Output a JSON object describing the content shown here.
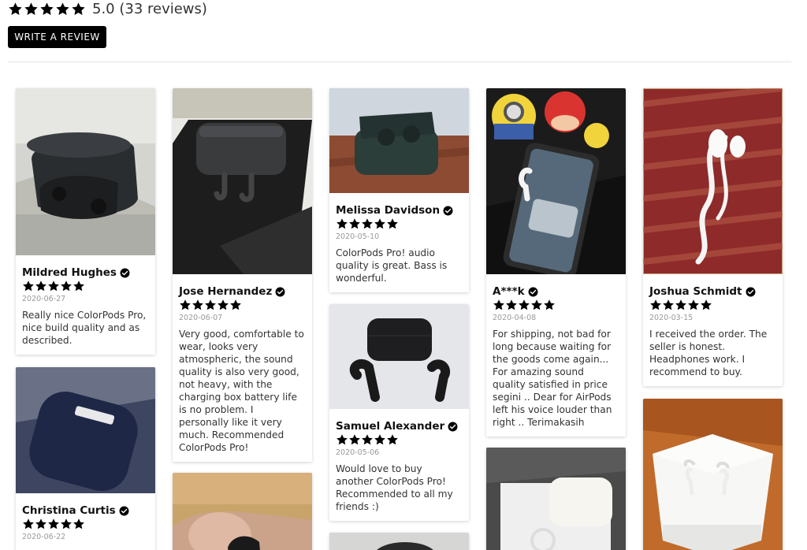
{
  "summary": {
    "score_text": "5.0 (33 reviews)",
    "stars": 5
  },
  "write_button": {
    "label": "WRITE A REVIEW"
  },
  "colors": {
    "star": "#000000",
    "button_bg": "#000000",
    "button_text": "#ffffff"
  },
  "reviews": [
    {
      "name": "Mildred Hughes",
      "date": "2020-06-27",
      "text": "Really nice ColorPods Pro, nice build quality and as described.",
      "rating": 5,
      "photo": "black earbuds case photo"
    },
    {
      "name": "Christina Curtis",
      "date": "2020-06-22",
      "text": "",
      "rating": 5,
      "photo": "navy earbuds case photo"
    },
    {
      "name": "Jose Hernandez",
      "date": "2020-06-07",
      "text": "Very good, comfortable to wear, looks very atmospheric, the sound quality is also very good, not heavy, with the charging box battery life is no problem. I personally like it very much. Recommended ColorPods Pro!",
      "rating": 5,
      "photo": "black case with earbuds photo"
    },
    {
      "name": "Melissa Davidson",
      "date": "2020-05-10",
      "text": "ColorPods Pro! audio quality is great. Bass is wonderful.",
      "rating": 5,
      "photo": "open case on wood photo"
    },
    {
      "name": "Samuel Alexander",
      "date": "2020-05-06",
      "text": "Would love to buy another ColorPods Pro! Recommended to all my friends :)",
      "rating": 5,
      "photo": "black case and earbuds on white photo"
    },
    {
      "name": "A***k",
      "date": "2020-04-08",
      "text": "For shipping, not bad for long because waiting for the goods come again... For amazing sound quality satisfied in price segini .. Dear for AirPods left his voice louder than right .. Terimakasih",
      "rating": 5,
      "photo": "phone with figurines photo"
    },
    {
      "name": "Joshua Schmidt",
      "date": "2020-03-15",
      "text": "I received the order. The seller is honest. Headphones work. I recommend to buy.",
      "rating": 5,
      "photo": "wired earphones photo"
    }
  ]
}
